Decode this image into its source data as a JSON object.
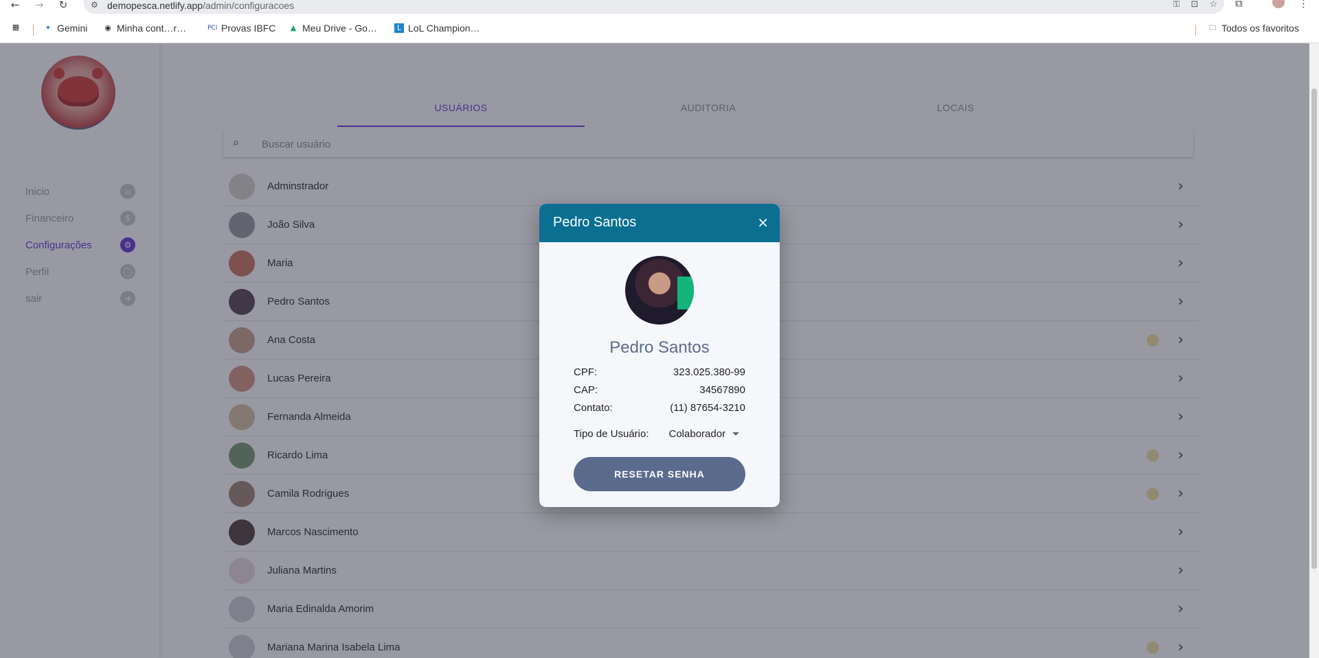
{
  "browser": {
    "url_host": "demopesca.netlify.app",
    "url_path": "/admin/configuracoes",
    "bookmarks": [
      {
        "label": "Gemini",
        "icon": "gemini-icon"
      },
      {
        "label": "Minha cont…r…",
        "icon": "github-icon"
      },
      {
        "label": "Provas IBFC",
        "icon": "pci-icon"
      },
      {
        "label": "Meu Drive - Go…",
        "icon": "drive-icon"
      },
      {
        "label": "LoL Champion…",
        "icon": "lol-icon"
      }
    ],
    "all_bookmarks_label": "Todos os favoritos"
  },
  "sidebar": {
    "items": [
      {
        "label": "Inicio",
        "icon": "home-icon"
      },
      {
        "label": "Financeiro",
        "icon": "money-icon"
      },
      {
        "label": "Configurações",
        "icon": "gear-icon",
        "active": true
      },
      {
        "label": "Perfil",
        "icon": "account-icon"
      },
      {
        "label": "sair",
        "icon": "logout-icon"
      }
    ]
  },
  "tabs": [
    "USUÁRIOS",
    "AUDITORIA",
    "LOCAIS"
  ],
  "search": {
    "placeholder": "Buscar usuário"
  },
  "users": [
    {
      "name": "Adminstrador",
      "badge": false
    },
    {
      "name": "João Silva",
      "badge": false
    },
    {
      "name": "Maria",
      "badge": false
    },
    {
      "name": "Pedro Santos",
      "badge": false
    },
    {
      "name": "Ana Costa",
      "badge": true
    },
    {
      "name": "Lucas Pereira",
      "badge": false
    },
    {
      "name": "Fernanda Almeida",
      "badge": false
    },
    {
      "name": "Ricardo Lima",
      "badge": true
    },
    {
      "name": "Camila Rodrigues",
      "badge": true
    },
    {
      "name": "Marcos Nascimento",
      "badge": false
    },
    {
      "name": "Juliana Martins",
      "badge": false
    },
    {
      "name": "Maria Edinalda Amorim",
      "badge": false
    },
    {
      "name": "Mariana Marina Isabela Lima",
      "badge": true
    }
  ],
  "modal": {
    "header_title": "Pedro Santos",
    "close_glyph": "×",
    "name": "Pedro Santos",
    "cpf_label": "CPF:",
    "cpf_value": "323.025.380-99",
    "cap_label": "CAP:",
    "cap_value": "34567890",
    "contato_label": "Contato:",
    "contato_value": "(11) 87654-3210",
    "tipo_label": "Tipo de Usuário:",
    "tipo_value": "Colaborador",
    "reset_label": "RESETAR SENHA"
  },
  "colors": {
    "accent": "#6a3fd6",
    "modal_header": "#0b6f92",
    "button": "#5b6b8e"
  }
}
